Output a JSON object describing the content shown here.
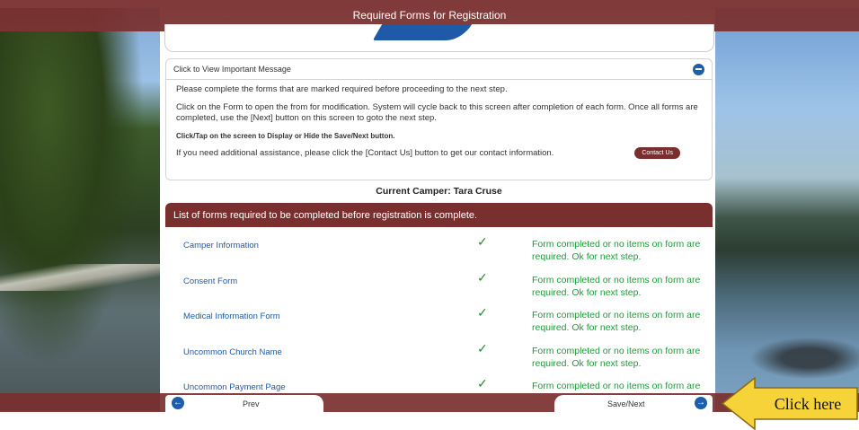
{
  "header": {
    "title": "Required Forms for Registration"
  },
  "message": {
    "toggle_label": "Click to View Important Message",
    "p1": "Please complete the forms that are marked required before proceeding to the next step.",
    "p2": "Click on the Form to open the from for modification. System will cycle back to this screen after completion of each form. Once all forms are completed, use the [Next] button on this screen to goto the next step.",
    "p3": "Click/Tap on the screen to Display or Hide the Save/Next button.",
    "p4": "If you need additional assistance, please click the [Contact Us] button to get our contact information.",
    "contact_label": "Contact Us"
  },
  "camper": {
    "label": "Current Camper: Tara Cruse"
  },
  "forms": {
    "header": "List of forms required to be completed before registration is complete.",
    "rows": [
      {
        "name": "Camper Information",
        "check": "✓",
        "status": "Form completed or no items on form are required. Ok for next step."
      },
      {
        "name": "Consent Form",
        "check": "✓",
        "status": "Form completed or no items on form are required. Ok for next step."
      },
      {
        "name": "Medical Information Form",
        "check": "✓",
        "status": "Form completed or no items on form are required. Ok for next step."
      },
      {
        "name": "Uncommon Church Name",
        "check": "✓",
        "status": "Form completed or no items on form are required. Ok for next step."
      },
      {
        "name": "Uncommon Payment Page",
        "check": "✓",
        "status": "Form completed or no items on form are required. Ok for next step."
      }
    ]
  },
  "nav": {
    "prev_label": "Prev",
    "next_label": "Save/Next"
  },
  "callout": {
    "text": "Click here"
  },
  "colors": {
    "brand": "#7a2f2f",
    "link": "#1f5aa8",
    "success": "#1e9a3a"
  }
}
